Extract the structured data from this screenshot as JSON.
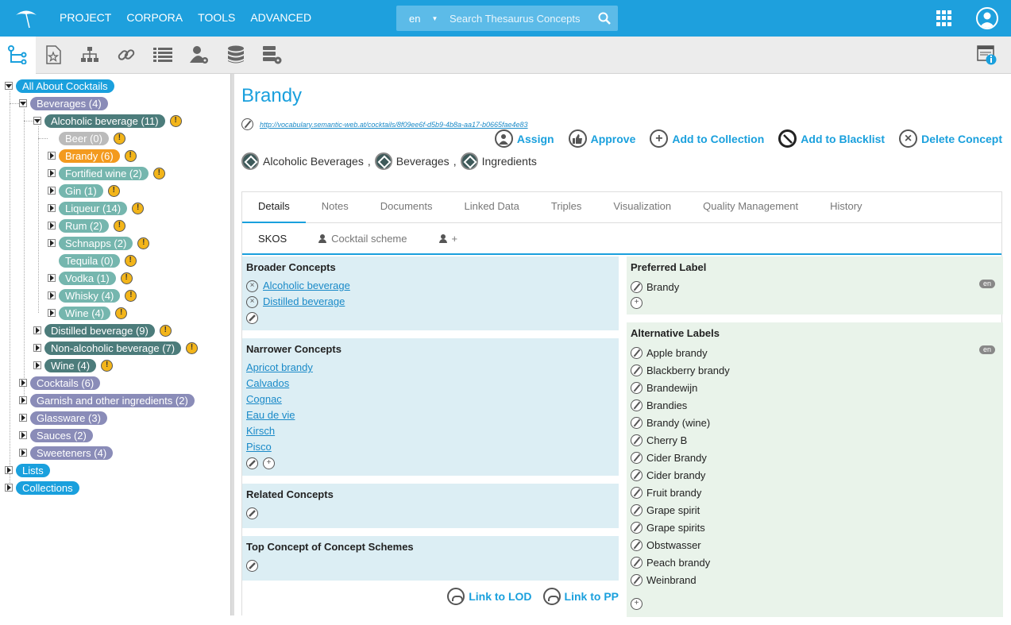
{
  "topbar": {
    "menu": [
      "PROJECT",
      "CORPORA",
      "TOOLS",
      "ADVANCED"
    ],
    "search_lang": "en",
    "search_placeholder": "Search Thesaurus Concepts"
  },
  "tree": {
    "root": {
      "label": "All About Cocktails"
    },
    "beverages": {
      "label": "Beverages (4)"
    },
    "alcoholic": {
      "label": "Alcoholic beverage (11)"
    },
    "alc_children": [
      {
        "label": "Beer (0)"
      },
      {
        "label": "Brandy (6)"
      },
      {
        "label": "Fortified wine (2)"
      },
      {
        "label": "Gin (1)"
      },
      {
        "label": "Liqueur (14)"
      },
      {
        "label": "Rum (2)"
      },
      {
        "label": "Schnapps (2)"
      },
      {
        "label": "Tequila (0)"
      },
      {
        "label": "Vodka (1)"
      },
      {
        "label": "Whisky (4)"
      },
      {
        "label": "Wine (4)"
      }
    ],
    "bev_children": [
      {
        "label": "Distilled beverage (9)"
      },
      {
        "label": "Non-alcoholic beverage (7)"
      },
      {
        "label": "Wine (4)"
      }
    ],
    "root_children": [
      {
        "label": "Cocktails (6)"
      },
      {
        "label": "Garnish and other ingredients (2)"
      },
      {
        "label": "Glassware (3)"
      },
      {
        "label": "Sauces (2)"
      },
      {
        "label": "Sweeteners (4)"
      }
    ],
    "lists": {
      "label": "Lists"
    },
    "collections": {
      "label": "Collections"
    },
    "warn_glyph": "!"
  },
  "concept": {
    "title": "Brandy",
    "uri": "http://vocabulary.semantic-web.at/cocktails/8f09ee6f-d5b9-4b8a-aa17-b0665fae4e83",
    "actions": {
      "assign": "Assign",
      "approve": "Approve",
      "add_collection": "Add to Collection",
      "add_blacklist": "Add to Blacklist",
      "delete": "Delete Concept"
    },
    "schemes": [
      "Alcoholic Beverages",
      "Beverages",
      "Ingredients"
    ],
    "scheme_sep": ","
  },
  "tabs": [
    "Details",
    "Notes",
    "Documents",
    "Linked Data",
    "Triples",
    "Visualization",
    "Quality Management",
    "History"
  ],
  "subtabs": {
    "skos": "SKOS",
    "scheme": "Cocktail scheme",
    "plus": "+"
  },
  "broader": {
    "heading": "Broader Concepts",
    "items": [
      "Alcoholic beverage",
      "Distilled beverage"
    ]
  },
  "narrower": {
    "heading": "Narrower Concepts",
    "items": [
      "Apricot brandy",
      "Calvados",
      "Cognac",
      "Eau de vie",
      "Kirsch",
      "Pisco"
    ]
  },
  "related": {
    "heading": "Related Concepts"
  },
  "topconcept": {
    "heading": "Top Concept of Concept Schemes"
  },
  "lod": {
    "link_lod": "Link to LOD",
    "link_pp": "Link to PP"
  },
  "preferred": {
    "heading": "Preferred Label",
    "value": "Brandy",
    "lang": "en"
  },
  "alternative": {
    "heading": "Alternative Labels",
    "lang": "en",
    "items": [
      "Apple brandy",
      "Blackberry brandy",
      "Brandewijn",
      "Brandies",
      "Brandy (wine)",
      "Cherry B",
      "Cider Brandy",
      "Cider brandy",
      "Fruit brandy",
      "Grape spirit",
      "Grape spirits",
      "Obstwasser",
      "Peach brandy",
      "Weinbrand"
    ]
  },
  "colors": {
    "accent": "#1ea0dd",
    "warning": "#f3b51a",
    "selected": "#f39a1e"
  }
}
